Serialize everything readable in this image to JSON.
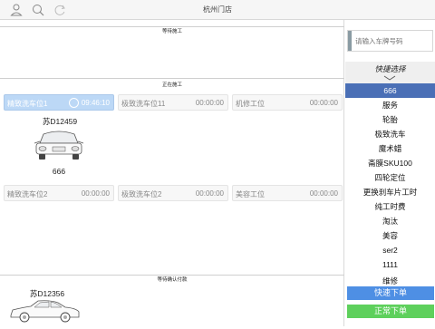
{
  "header": {
    "title": "杭州门店",
    "icons": [
      "user-icon",
      "search-icon",
      "refresh-icon"
    ]
  },
  "sections": {
    "waiting": "等待施工",
    "in_progress": "正在施工",
    "awaiting_payment": "等待确认付款"
  },
  "stations_row1": [
    {
      "name": "精致洗车位1",
      "time": "09:46:10",
      "active": true
    },
    {
      "name": "极致洗车位11",
      "time": "00:00:00",
      "active": false
    },
    {
      "name": "机修工位",
      "time": "00:00:00",
      "active": false
    }
  ],
  "stations_row2": [
    {
      "name": "精致洗车位2",
      "time": "00:00:00"
    },
    {
      "name": "极致洗车位2",
      "time": "00:00:00"
    },
    {
      "name": "美容工位",
      "time": "00:00:00"
    }
  ],
  "in_progress_car": {
    "plate": "苏D12459",
    "count": "666"
  },
  "payment_car": {
    "plate": "苏D12356"
  },
  "search": {
    "placeholder": "请输入车牌号码"
  },
  "quick": {
    "header": "快捷选择",
    "items": [
      "666",
      "服务",
      "轮胎",
      "极致洗车",
      "魔术蜡",
      "斋膜SKU100",
      "四轮定位",
      "更换刹车片工时",
      "纯工时费",
      "淘汰",
      "美容",
      "ser2",
      "1111",
      "维修"
    ],
    "selected": "666"
  },
  "buttons": {
    "quick_order": "快速下单",
    "normal_order": "正常下单"
  },
  "colors": {
    "selected": "#4a6fb6",
    "active_station": "#bcd8f6",
    "quick_order": "#4e8fe4",
    "normal_order": "#5ed05c"
  }
}
